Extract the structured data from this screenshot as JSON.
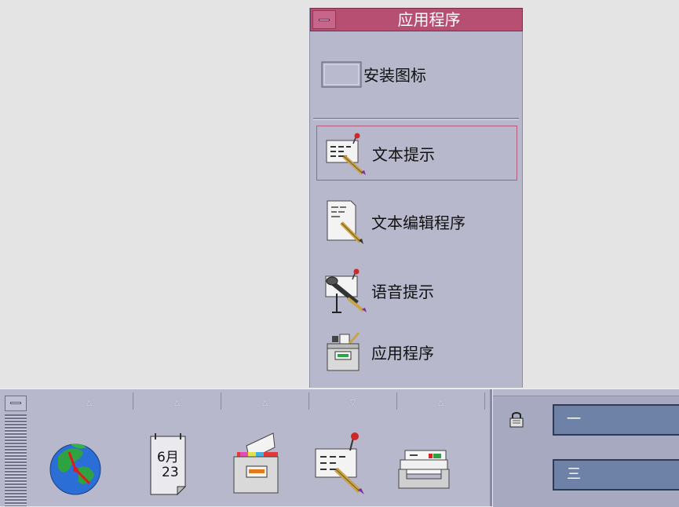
{
  "subpanel": {
    "title": "应用程序",
    "items": [
      {
        "label": "安装图标",
        "icon": "install-icon-drop-zone"
      },
      {
        "label": "文本提示",
        "icon": "text-note-icon"
      },
      {
        "label": "文本编辑程序",
        "icon": "text-editor-icon"
      },
      {
        "label": "语音提示",
        "icon": "voice-note-icon"
      },
      {
        "label": "应用程序",
        "icon": "application-manager-icon"
      }
    ]
  },
  "frontpanel": {
    "calendar": {
      "month": "6月",
      "day": "23"
    },
    "icons": [
      "clock-globe-icon",
      "calendar-icon",
      "file-manager-icon",
      "text-note-icon",
      "mail-icon"
    ],
    "workspaces": [
      "一",
      "三"
    ]
  }
}
